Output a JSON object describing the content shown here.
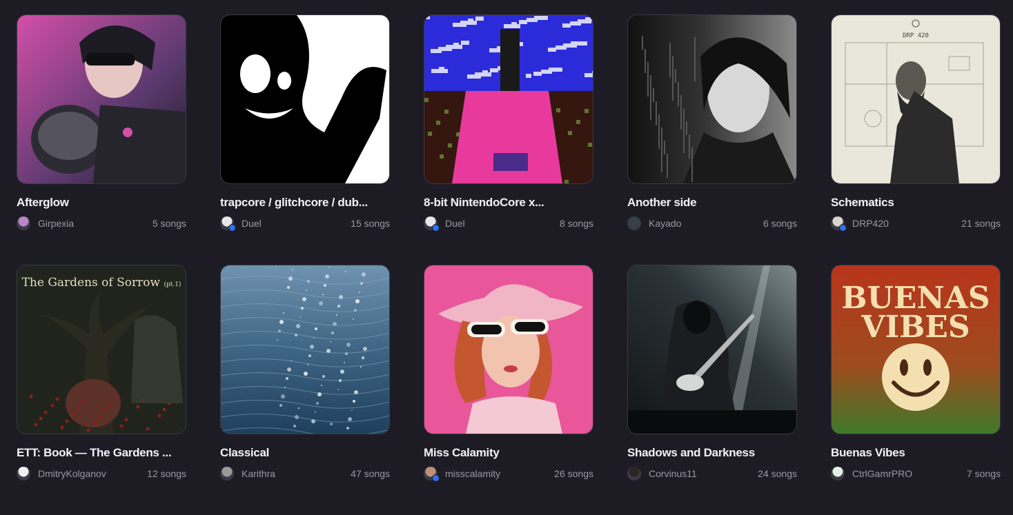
{
  "playlists": [
    {
      "title": "Afterglow",
      "creator": "Girpexia",
      "count": "5 songs",
      "verified": false,
      "avatar_color": "#b886c9",
      "colors": [
        "#d44fa9",
        "#5b3a6f",
        "#1c1a22"
      ],
      "art": "portrait-pink"
    },
    {
      "title": "trapcore / glitchcore / dub...",
      "creator": "Duel",
      "count": "15 songs",
      "verified": true,
      "avatar_color": "#e8e8ea",
      "colors": [
        "#ffffff",
        "#000000"
      ],
      "art": "silhouette-bw"
    },
    {
      "title": "8-bit NintendoCore x...",
      "creator": "Duel",
      "count": "8 songs",
      "verified": true,
      "avatar_color": "#e8e8ea",
      "colors": [
        "#2b2bd9",
        "#e83a9c",
        "#35160f"
      ],
      "art": "glitch-kimono"
    },
    {
      "title": "Another side",
      "creator": "Kayado",
      "count": "6 songs",
      "verified": false,
      "avatar_color": "#35404a",
      "colors": [
        "#111111",
        "#8a8a8a",
        "#d8d8d8"
      ],
      "art": "portrait-bw"
    },
    {
      "title": "Schematics",
      "creator": "DRP420",
      "count": "21 songs",
      "verified": true,
      "avatar_color": "#d9d6c9",
      "colors": [
        "#e9e6da",
        "#2b2b2b"
      ],
      "art": "schematic",
      "cover_text": "DRP 420"
    },
    {
      "title": "ETT: Book — The Gardens ...",
      "creator": "DmitryKolganov",
      "count": "12 songs",
      "verified": false,
      "avatar_color": "#f0f0f0",
      "colors": [
        "#20241d",
        "#5b3128",
        "#8a1f1a"
      ],
      "art": "dark-tree",
      "cover_text": "The Gardens of Sorrow",
      "cover_subtext": "(pt.1)"
    },
    {
      "title": "Classical",
      "creator": "Karithra",
      "count": "47 songs",
      "verified": false,
      "avatar_color": "#9a9a9a",
      "colors": [
        "#1f3f5e",
        "#6f93b0",
        "#e5edf2"
      ],
      "art": "ocean"
    },
    {
      "title": "Miss Calamity",
      "creator": "misscalamity",
      "count": "26 songs",
      "verified": true,
      "avatar_color": "#c08f7a",
      "colors": [
        "#e9569a",
        "#c4572f",
        "#f0b6c6"
      ],
      "art": "cowgirl"
    },
    {
      "title": "Shadows and Darkness",
      "creator": "Corvinus11",
      "count": "24 songs",
      "verified": false,
      "avatar_color": "#2a2722",
      "colors": [
        "#121416",
        "#2b3438",
        "#7d8a8c"
      ],
      "art": "guitarist"
    },
    {
      "title": "Buenas Vibes",
      "creator": "CtrlGamrPRO",
      "count": "7 songs",
      "verified": false,
      "avatar_color": "#e2efe8",
      "colors": [
        "#b8341c",
        "#9d4c1f",
        "#3f7a2a",
        "#f4dfb0"
      ],
      "art": "smiley",
      "cover_text": "BUENAS",
      "cover_subtext": "VIBES"
    }
  ]
}
